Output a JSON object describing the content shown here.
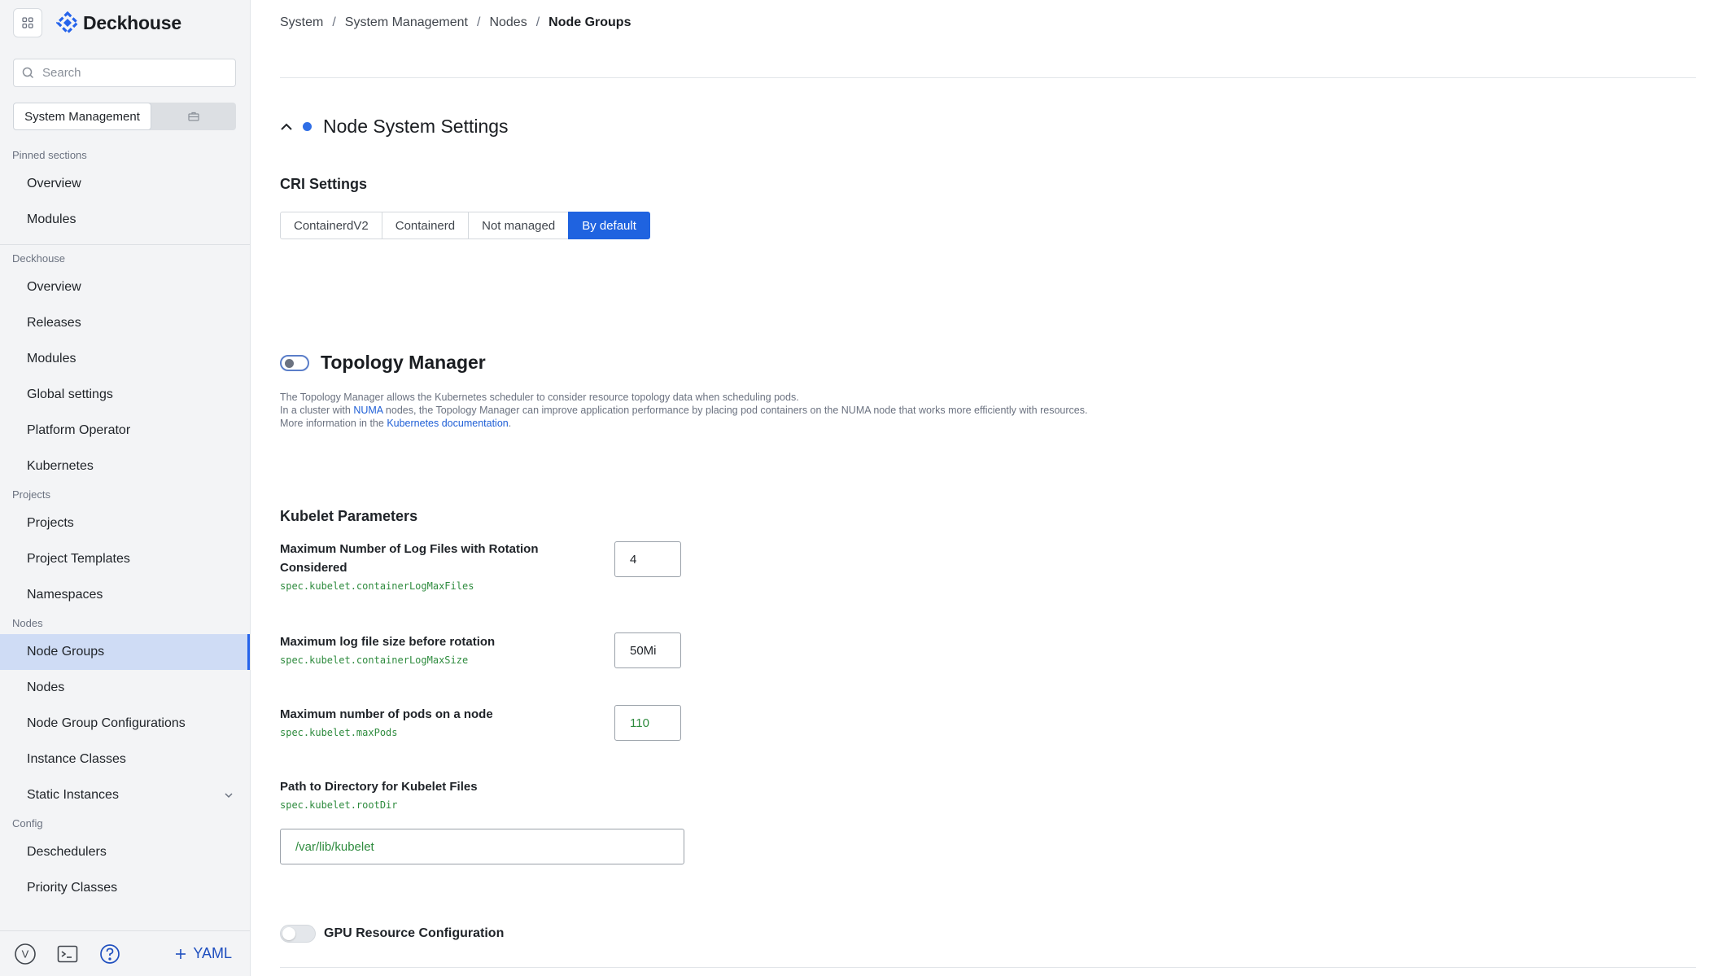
{
  "app": {
    "name": "Deckhouse"
  },
  "search": {
    "placeholder": "Search"
  },
  "switcher": {
    "active_label": "System Management"
  },
  "sidebar": {
    "sections": [
      {
        "title": "Pinned sections",
        "items": [
          "Overview",
          "Modules"
        ]
      },
      {
        "title": "Deckhouse",
        "items": [
          "Overview",
          "Releases",
          "Modules",
          "Global settings",
          "Platform Operator",
          "Kubernetes"
        ]
      },
      {
        "title": "Projects",
        "items": [
          "Projects",
          "Project Templates",
          "Namespaces"
        ]
      },
      {
        "title": "Nodes",
        "items": [
          "Node Groups",
          "Nodes",
          "Node Group Configurations",
          "Instance Classes",
          "Static Instances"
        ]
      },
      {
        "title": "Config",
        "items": [
          "Deschedulers",
          "Priority Classes"
        ]
      }
    ],
    "active_item": "Node Groups"
  },
  "footer": {
    "avatar_letter": "V",
    "yaml_label": "YAML"
  },
  "breadcrumb": {
    "items": [
      "System",
      "System Management",
      "Nodes"
    ],
    "current": "Node Groups"
  },
  "section": {
    "title": "Node System Settings"
  },
  "cri": {
    "label": "CRI Settings",
    "options": [
      "ContainerdV2",
      "Containerd",
      "Not managed",
      "By default"
    ],
    "selected": "By default"
  },
  "topology": {
    "title": "Topology Manager",
    "line1": "The Topology Manager allows the Kubernetes scheduler to consider resource topology data when scheduling pods.",
    "line2_pre": "In a cluster with ",
    "line2_link": "NUMA",
    "line2_post": " nodes, the Topology Manager can improve application performance by placing pod containers on the NUMA node that works more efficiently with resources.",
    "line3_pre": "More information in the ",
    "line3_link": "Kubernetes documentation",
    "line3_post": "."
  },
  "kubelet": {
    "title": "Kubelet Parameters",
    "params": [
      {
        "label": "Maximum Number of Log Files with Rotation Considered",
        "path": "spec.kubelet.containerLogMaxFiles",
        "value": "4"
      },
      {
        "label": "Maximum log file size before rotation",
        "path": "spec.kubelet.containerLogMaxSize",
        "value": "50Mi"
      },
      {
        "label": "Maximum number of pods on a node",
        "path": "spec.kubelet.maxPods",
        "value": "110"
      },
      {
        "label": "Path to Directory for Kubelet Files",
        "path": "spec.kubelet.rootDir",
        "value": "/var/lib/kubelet"
      }
    ]
  },
  "gpu": {
    "label": "GPU Resource Configuration"
  },
  "colors": {
    "accent": "#1f63e0",
    "active_nav_bg": "#cfdcf5",
    "code_green": "#2e8b3e",
    "link": "#1f5fd6"
  }
}
